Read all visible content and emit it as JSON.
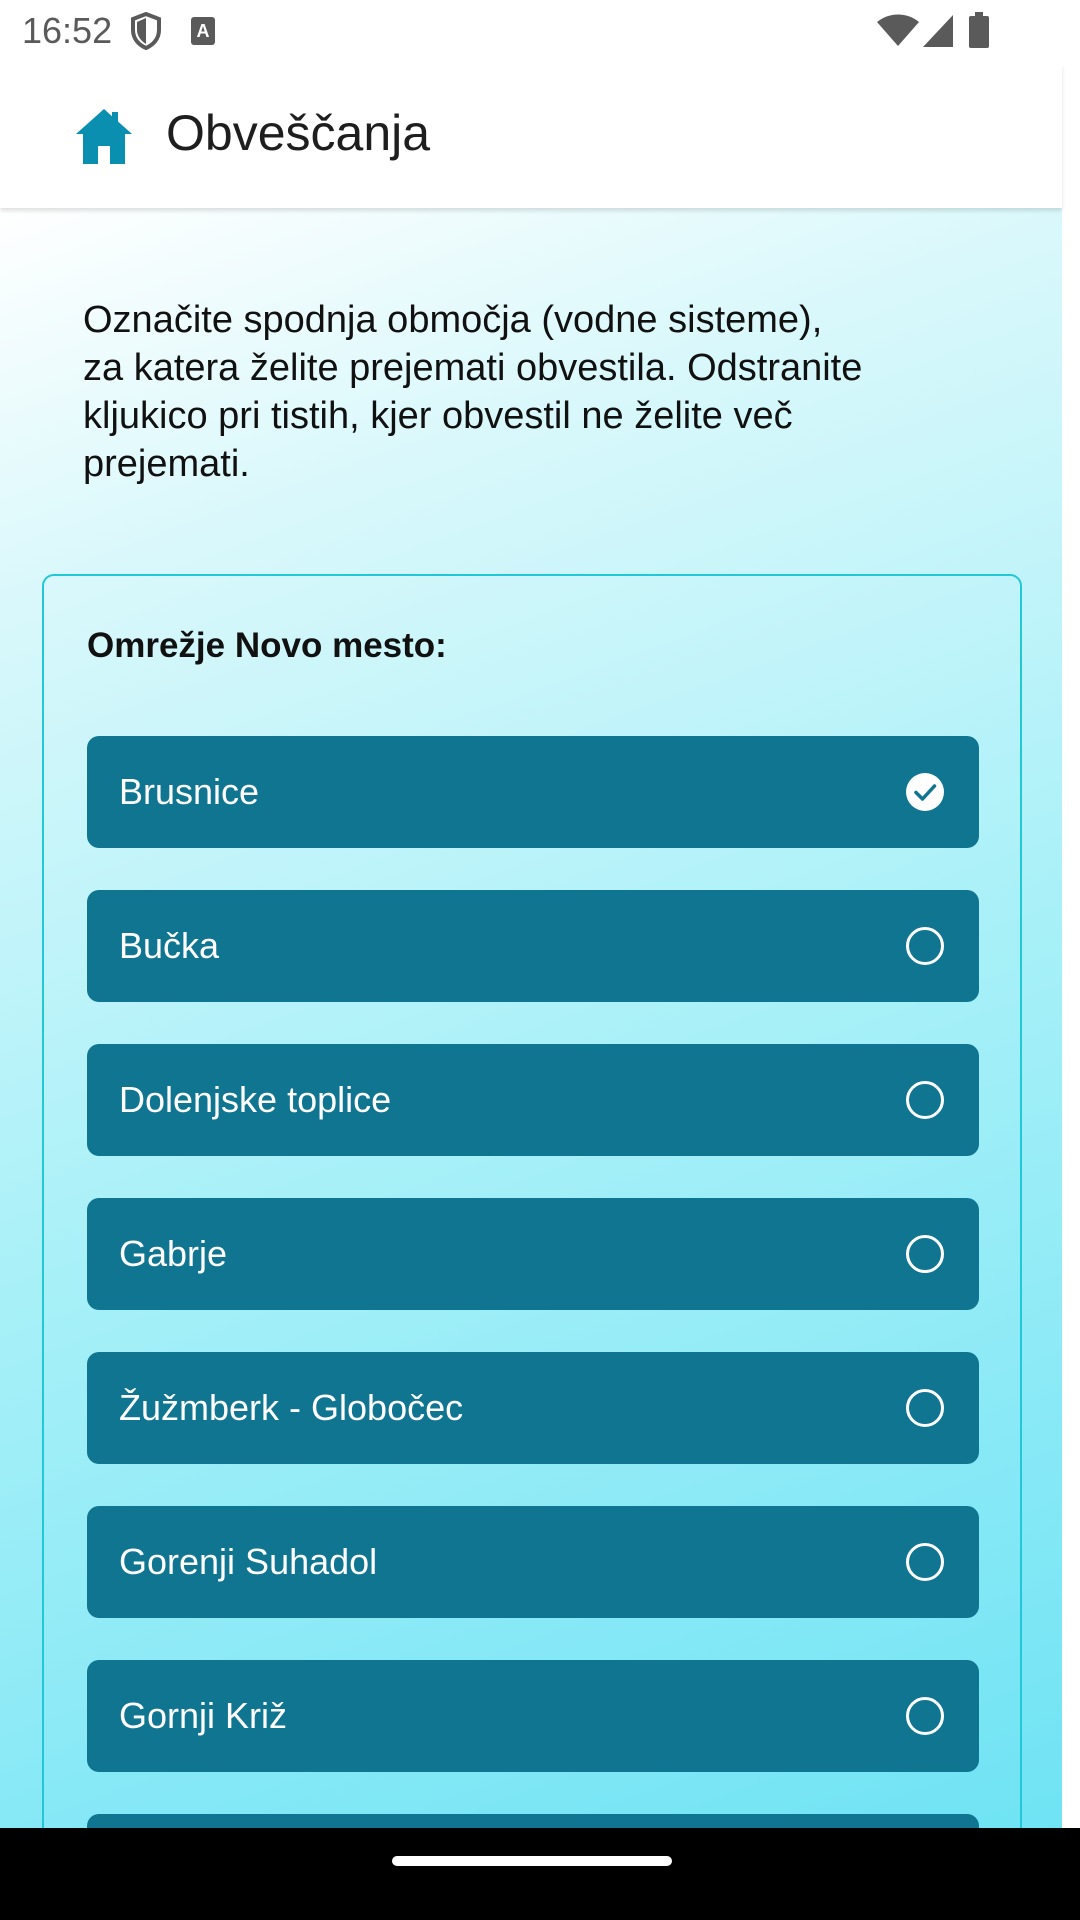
{
  "status_bar": {
    "time": "16:52",
    "icons_left": [
      "shield-icon",
      "font-a-icon"
    ],
    "icons_right": [
      "wifi-icon",
      "signal-icon",
      "battery-icon"
    ]
  },
  "app_bar": {
    "icon": "home-icon",
    "title": "Obveščanja"
  },
  "intro": {
    "text": "Označite spodnja območja (vodne sisteme),\nza katera želite prejemati obvestila. Odstranite\nkljukico pri tistih, kjer obvestil ne želite več\nprejemati."
  },
  "network": {
    "title": "Omrežje Novo mesto:",
    "options": [
      {
        "label": "Brusnice",
        "checked": true
      },
      {
        "label": "Bučka",
        "checked": false
      },
      {
        "label": "Dolenjske toplice",
        "checked": false
      },
      {
        "label": "Gabrje",
        "checked": false
      },
      {
        "label": "Žužmberk - Globočec",
        "checked": false
      },
      {
        "label": "Gorenji Suhadol",
        "checked": false
      },
      {
        "label": "Gornji Križ",
        "checked": false
      },
      {
        "label": "",
        "checked": false
      }
    ]
  },
  "colors": {
    "accent": "#0f7591",
    "home_icon": "#0a8fb0",
    "card_border": "#22c8d8"
  }
}
